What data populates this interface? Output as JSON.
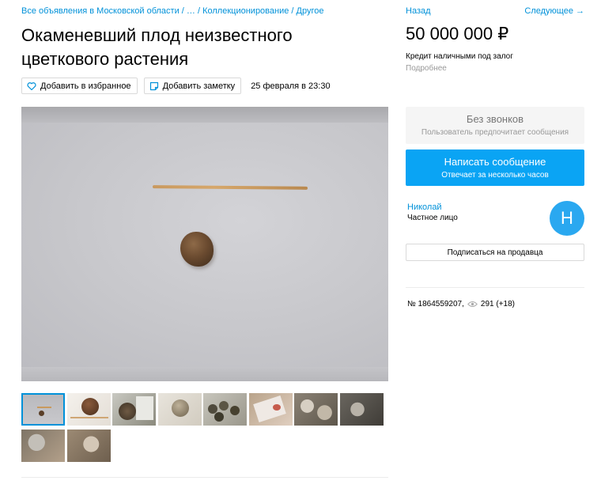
{
  "breadcrumbs": {
    "c1": "Все объявления в Московской области",
    "c2": "…",
    "c3": "Коллекционирование",
    "c4": "Другое",
    "separator": "/"
  },
  "title": "Окаменевший плод неизвестного цветкового растения",
  "actions": {
    "favorite_label": "Добавить в избранное",
    "note_label": "Добавить заметку",
    "posted_at": "25 февраля в 23:30"
  },
  "nav": {
    "back": "Назад",
    "next": "Следующее →"
  },
  "price": "50 000 000 ₽",
  "credit_text": "Кредит наличными под залог",
  "credit_more": "Подробнее",
  "no_calls": {
    "heading": "Без звонков",
    "subtext": "Пользователь предпочитает сообщения"
  },
  "write_message": {
    "heading": "Написать сообщение",
    "subtext": "Отвечает за несколько часов"
  },
  "seller": {
    "name": "Николай",
    "type": "Частное лицо",
    "avatar_letter": "Н"
  },
  "subscribe_label": "Подписаться на продавца",
  "listing": {
    "number": "№ 1864559207,",
    "views": "291 (+18)"
  },
  "thumbnails": [
    {
      "name": "thumb-1",
      "active": true
    },
    {
      "name": "thumb-2",
      "active": false
    },
    {
      "name": "thumb-3",
      "active": false
    },
    {
      "name": "thumb-4",
      "active": false
    },
    {
      "name": "thumb-5",
      "active": false
    },
    {
      "name": "thumb-6",
      "active": false
    },
    {
      "name": "thumb-7",
      "active": false
    },
    {
      "name": "thumb-8",
      "active": false
    },
    {
      "name": "thumb-9",
      "active": false
    },
    {
      "name": "thumb-10",
      "active": false
    }
  ],
  "colors": {
    "link": "#0091d9",
    "primary_button": "#0aa4f4",
    "avatar": "#2aa8f0"
  }
}
